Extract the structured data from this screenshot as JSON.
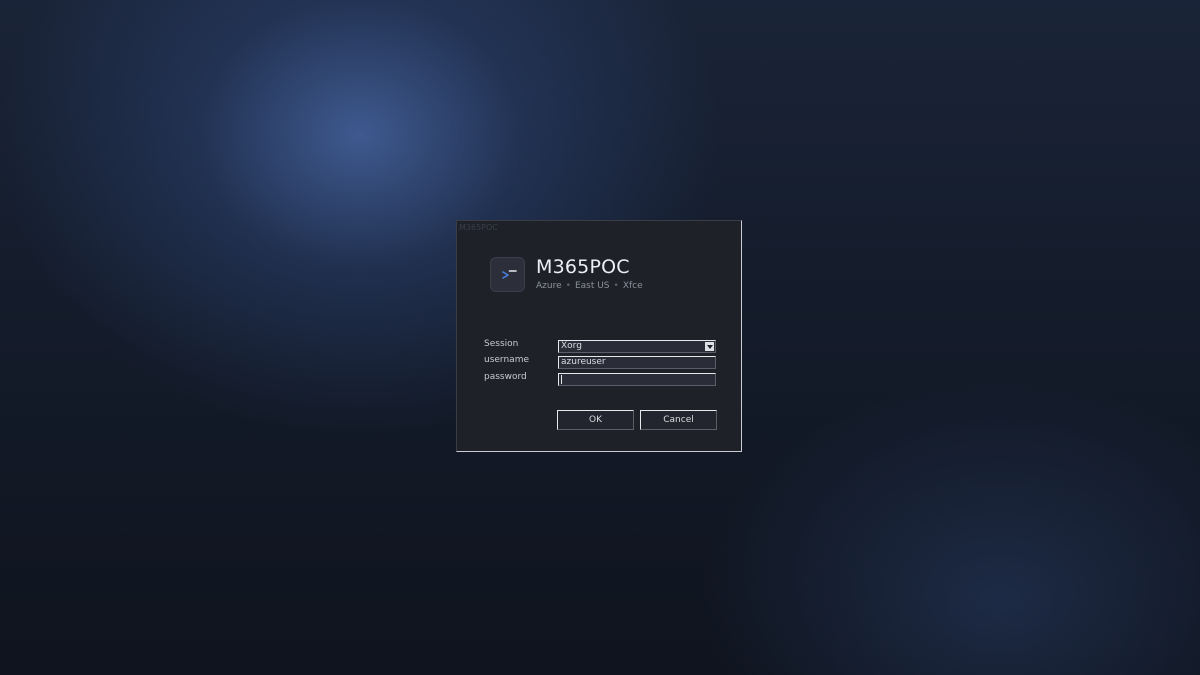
{
  "dialog": {
    "title": "M365POC"
  },
  "header": {
    "logo_icon": "terminal-prompt-icon",
    "app_name": "M365POC",
    "subtitle_parts": [
      "Azure",
      "East US",
      "Xfce"
    ],
    "separator": "•"
  },
  "form": {
    "session_label": "Session",
    "session_value": "Xorg",
    "username_label": "username",
    "username_value": "azureuser",
    "password_label": "password",
    "password_value": ""
  },
  "buttons": {
    "ok_label": "OK",
    "cancel_label": "Cancel"
  },
  "colors": {
    "accent": "#4a80e0",
    "dialog_bg": "#1f2129"
  }
}
